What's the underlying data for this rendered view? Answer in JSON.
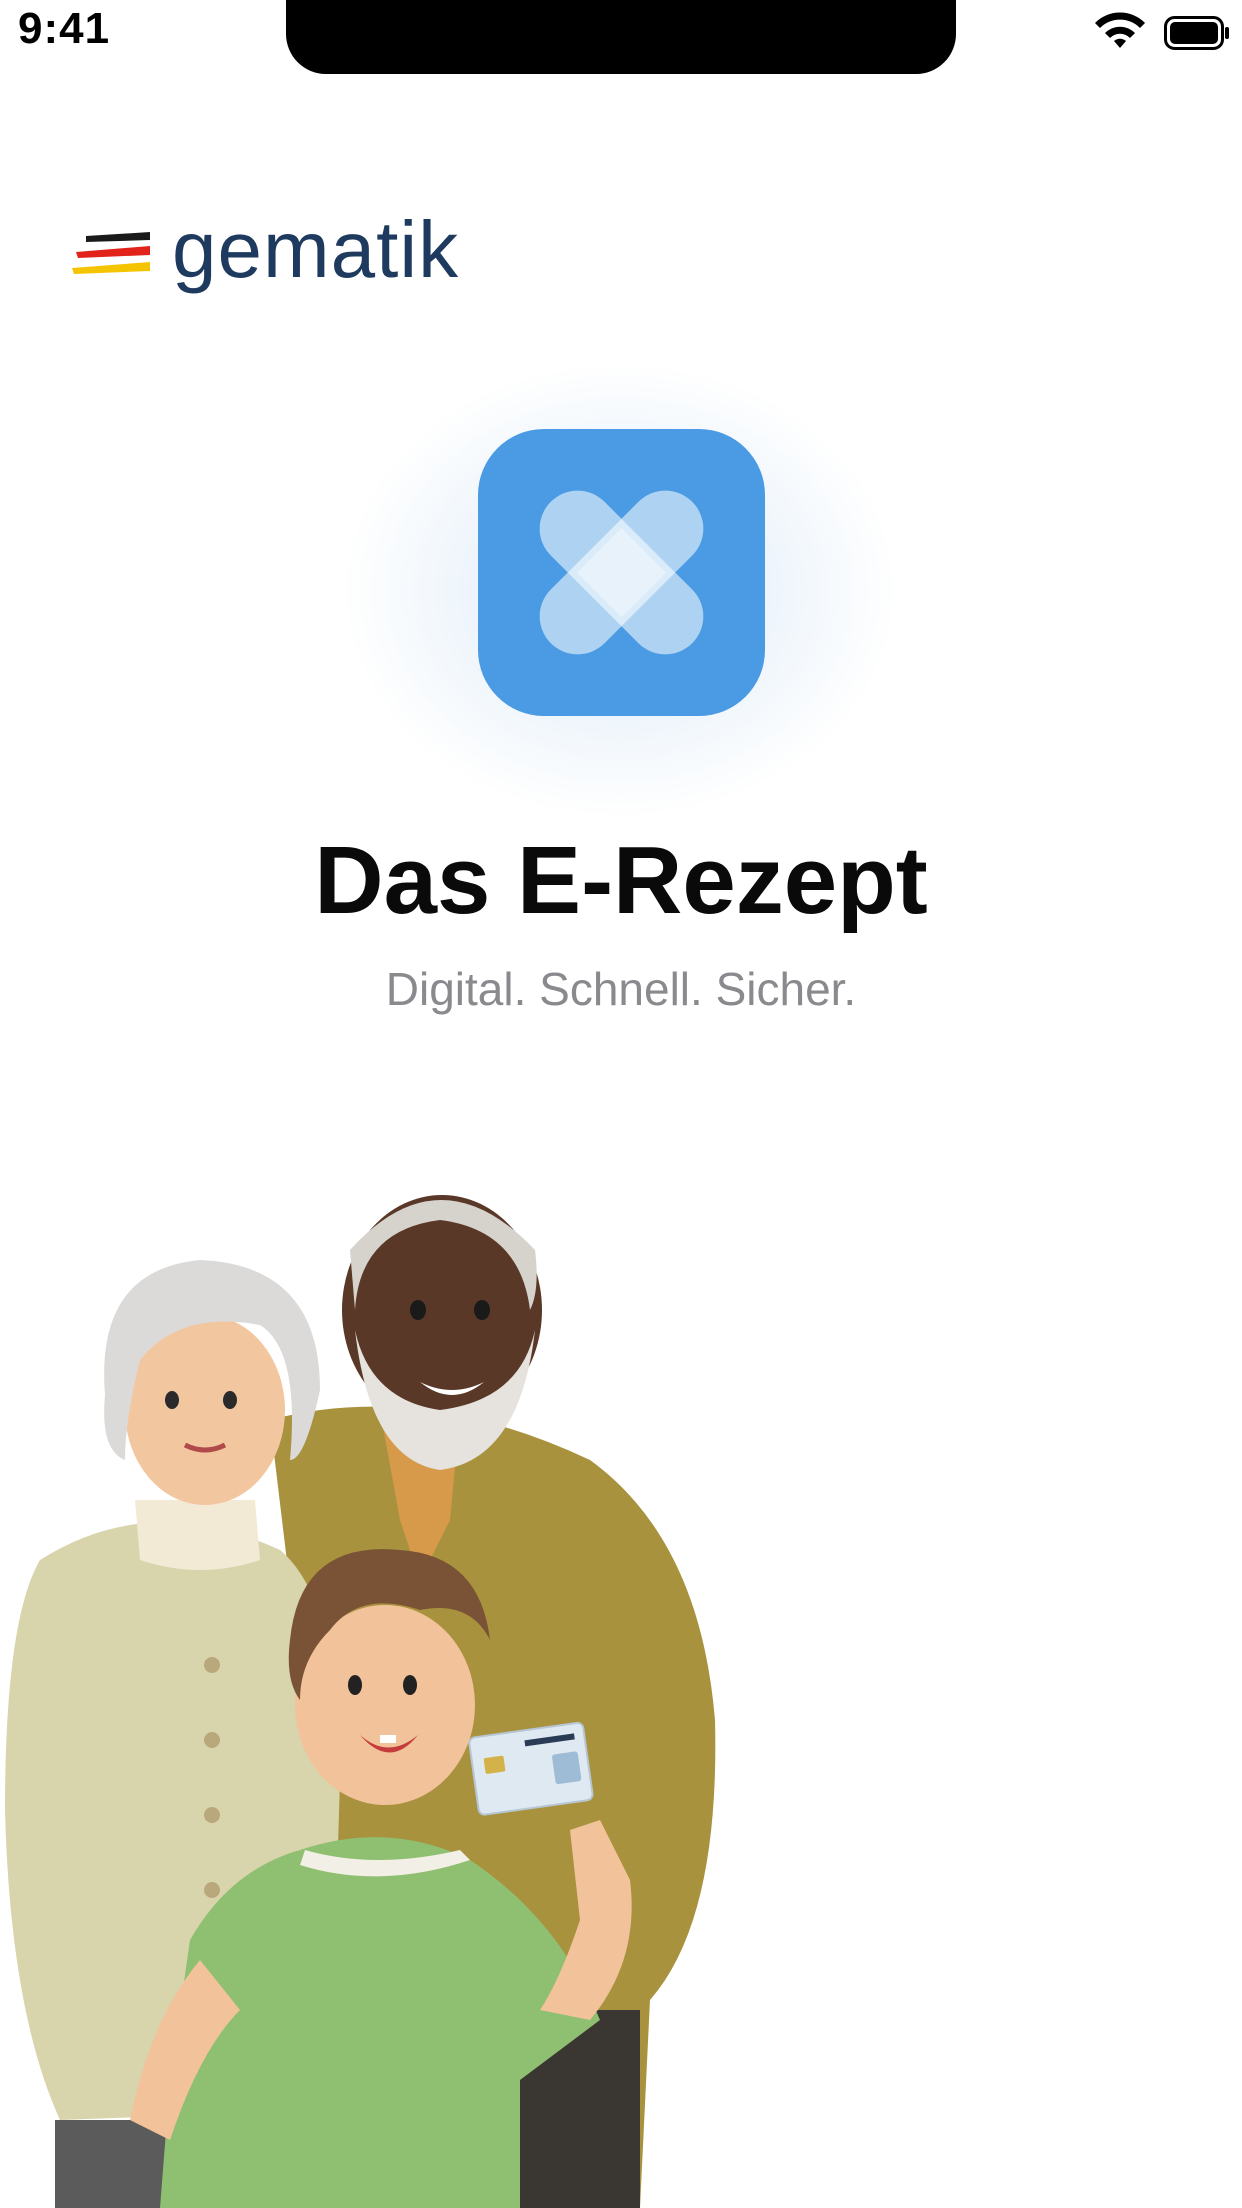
{
  "status_bar": {
    "time": "9:41"
  },
  "brand": {
    "name": "gematik"
  },
  "app": {
    "title": "Das E-Rezept",
    "subtitle": "Digital. Schnell. Sicher."
  },
  "icons": {
    "app_icon": "bandage-plaster-icon",
    "flag": "german-flag-stripes-icon",
    "wifi": "wifi-icon",
    "battery": "battery-icon"
  },
  "colors": {
    "accent_blue": "#4a9be3",
    "brand_navy": "#1f3a5f",
    "subtitle_gray": "#8a8a8e"
  }
}
